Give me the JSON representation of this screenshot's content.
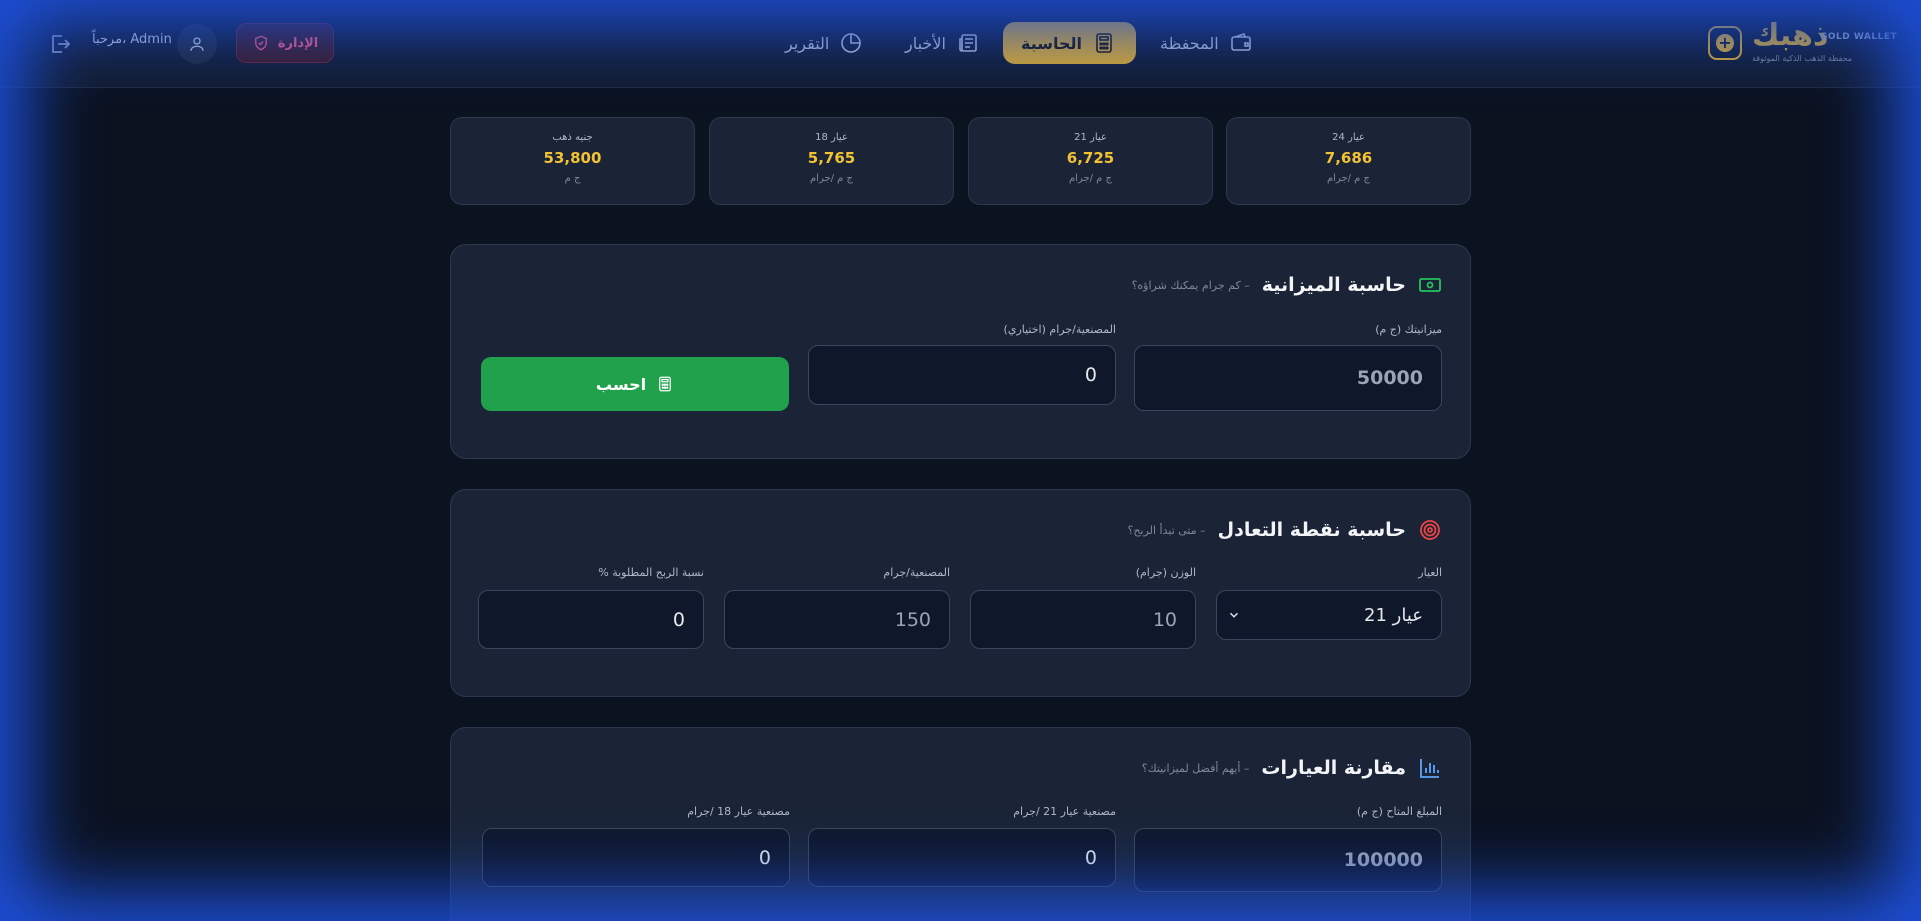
{
  "brand": {
    "name": "ذهبك",
    "name_en": "GOLD WALLET",
    "tagline": "محفظة الذهب الذكية الموثوقة"
  },
  "nav": {
    "items": [
      {
        "label": "المحفظة",
        "icon": "wallet-icon"
      },
      {
        "label": "الحاسبة",
        "icon": "calculator-icon",
        "active": true
      },
      {
        "label": "الأخبار",
        "icon": "newspaper-icon"
      },
      {
        "label": "التقرير",
        "icon": "pie-chart-icon"
      }
    ]
  },
  "user": {
    "admin_label": "الإدارة",
    "welcome": "مرحباً، Admin"
  },
  "prices": [
    {
      "label": "عيار 24",
      "value": "7,686",
      "unit": "ج م /جرام"
    },
    {
      "label": "عيار 21",
      "value": "6,725",
      "unit": "ج م /جرام"
    },
    {
      "label": "عيار 18",
      "value": "5,765",
      "unit": "ج م /جرام"
    },
    {
      "label": "جنيه ذهب",
      "value": "53,800",
      "unit": "ج م"
    }
  ],
  "budget": {
    "title": "حاسبة الميزانية",
    "subtitle": "– كم جرام يمكنك شراؤه؟",
    "budget_label": "ميزانيتك (ج م)",
    "budget_value": "50000",
    "workmanship_label": "المصنعية/جرام (اختياري)",
    "workmanship_value": "0",
    "button_label": "احسب"
  },
  "breakeven": {
    "title": "حاسبة نقطة التعادل",
    "subtitle": "– متى تبدأ الربح؟",
    "karat_label": "العيار",
    "karat_value": "عيار 21",
    "weight_label": "الوزن (جرام)",
    "weight_value": "10",
    "workmanship_label": "المصنعية/جرام",
    "workmanship_value": "150",
    "profit_label": "نسبة الربح المطلوبة %",
    "profit_value": "0"
  },
  "compare": {
    "title": "مقارنة العيارات",
    "subtitle": "– أيهم أفضل لميزانيتك؟",
    "amount_label": "المبلغ المتاح (ج م)",
    "amount_value": "100000",
    "w21_label": "مصنعية عيار 21 /جرام",
    "w21_value": "0",
    "w18_label": "مصنعية عيار 18 /جرام",
    "w18_value": "0"
  },
  "colors": {
    "gold": "#d4a62a",
    "price_gold": "#f2c232",
    "green_button": "#22a14c",
    "admin_red": "#f0587a",
    "background": "#0b1220",
    "panel": "#1a2436"
  }
}
